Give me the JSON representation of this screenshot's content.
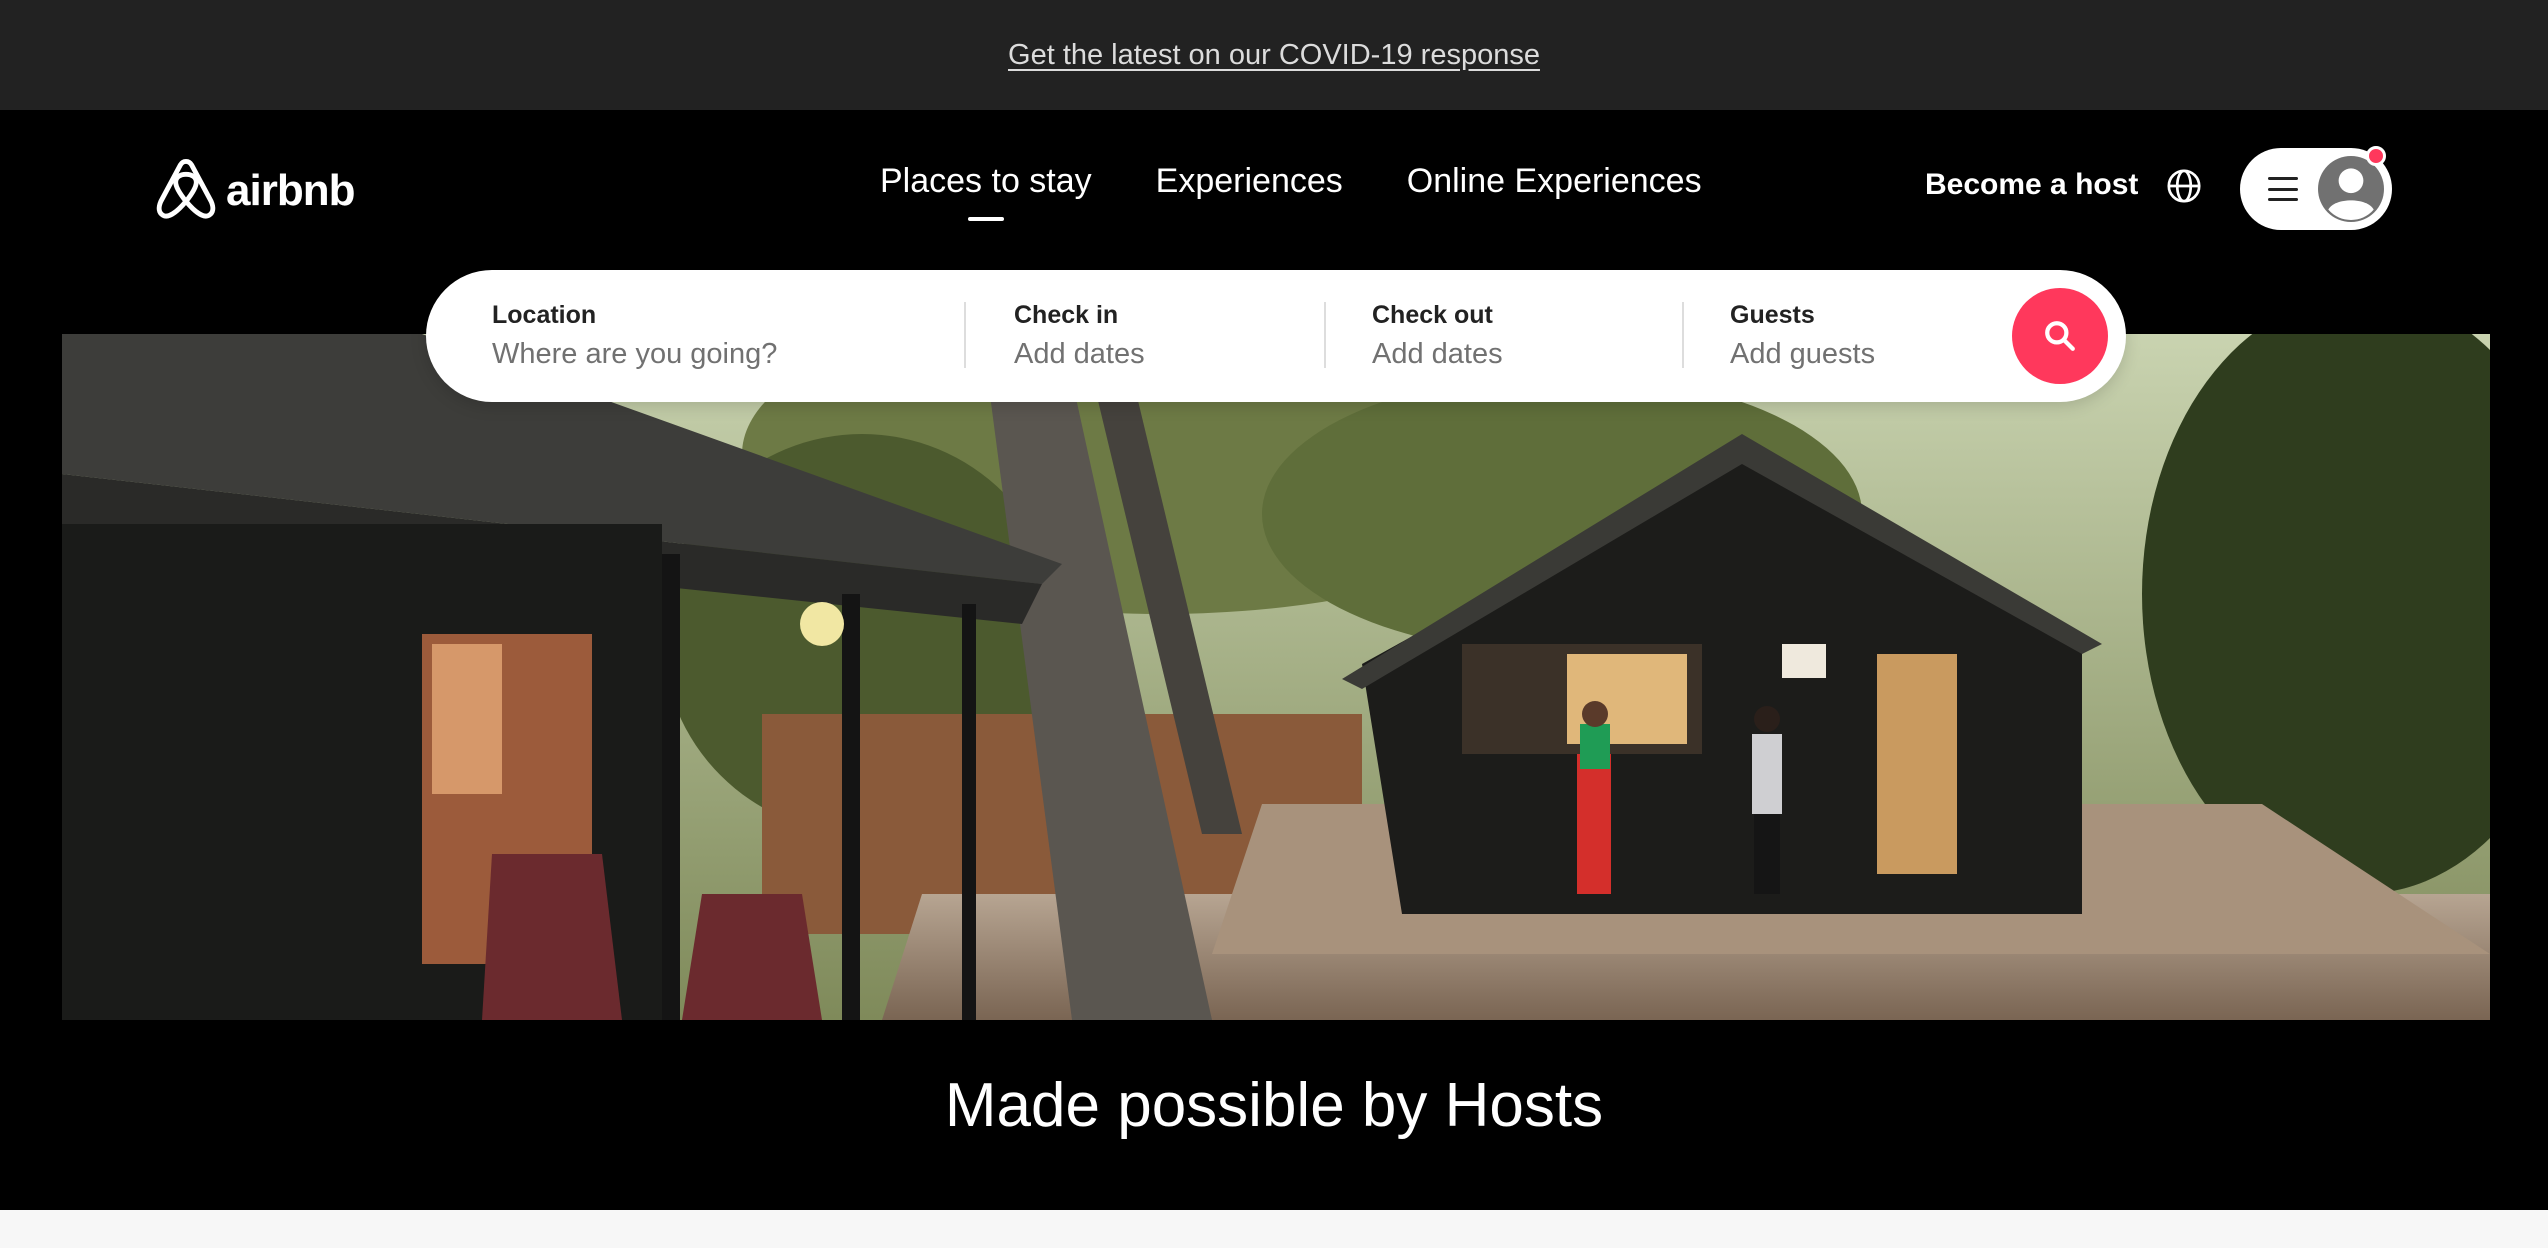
{
  "banner": {
    "link_text": "Get the latest on our COVID-19 response"
  },
  "header": {
    "logo_text": "airbnb",
    "nav": [
      {
        "label": "Places to stay",
        "active": true
      },
      {
        "label": "Experiences",
        "active": false
      },
      {
        "label": "Online Experiences",
        "active": false
      }
    ],
    "become_host": "Become a host",
    "globe_icon": "globe-icon",
    "menu_icon": "hamburger-icon",
    "avatar_icon": "user-avatar-icon",
    "notification_color": "#ff385c"
  },
  "search": {
    "location": {
      "label": "Location",
      "placeholder": "Where are you going?"
    },
    "check_in": {
      "label": "Check in",
      "placeholder": "Add dates"
    },
    "check_out": {
      "label": "Check out",
      "placeholder": "Add dates"
    },
    "guests": {
      "label": "Guests",
      "placeholder": "Add guests"
    },
    "button_icon": "search-icon",
    "button_color": "#ff385c"
  },
  "hero": {
    "image_alt": "hero-photo"
  },
  "tagline": "Made possible by Hosts"
}
